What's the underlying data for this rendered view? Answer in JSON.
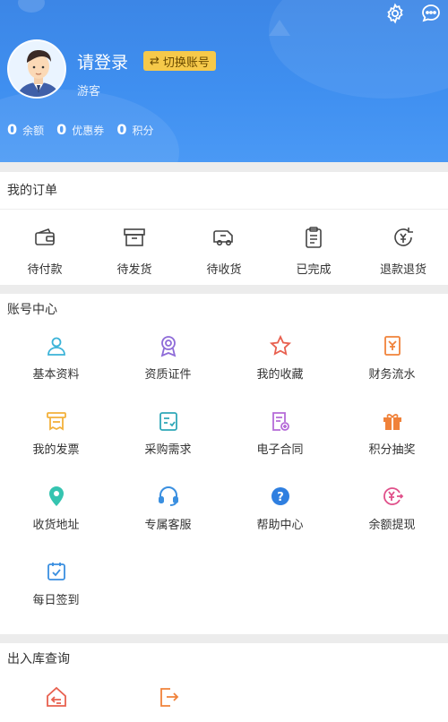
{
  "header": {
    "login_text": "请登录",
    "switch_label": "切换账号",
    "guest_label": "游客",
    "stats": [
      {
        "value": "0",
        "label": "余额"
      },
      {
        "value": "0",
        "label": "优惠券"
      },
      {
        "value": "0",
        "label": "积分"
      }
    ]
  },
  "orders": {
    "title": "我的订单",
    "items": [
      {
        "label": "待付款",
        "icon": "wallet-icon"
      },
      {
        "label": "待发货",
        "icon": "box-icon"
      },
      {
        "label": "待收货",
        "icon": "truck-icon"
      },
      {
        "label": "已完成",
        "icon": "clipboard-icon"
      },
      {
        "label": "退款退货",
        "icon": "refund-icon"
      }
    ]
  },
  "account": {
    "title": "账号中心",
    "items": [
      {
        "label": "基本资料",
        "icon": "user-icon",
        "color": "#3bb3d8"
      },
      {
        "label": "资质证件",
        "icon": "award-icon",
        "color": "#8e6bd8"
      },
      {
        "label": "我的收藏",
        "icon": "star-icon",
        "color": "#e8604f"
      },
      {
        "label": "财务流水",
        "icon": "finance-icon",
        "color": "#f0823a"
      },
      {
        "label": "我的发票",
        "icon": "invoice-icon",
        "color": "#f3b13b"
      },
      {
        "label": "采购需求",
        "icon": "purchase-icon",
        "color": "#2fa7b8"
      },
      {
        "label": "电子合同",
        "icon": "contract-icon",
        "color": "#b56bd8"
      },
      {
        "label": "积分抽奖",
        "icon": "gift-icon",
        "color": "#f0823a"
      },
      {
        "label": "收货地址",
        "icon": "location-icon",
        "color": "#35c4b0"
      },
      {
        "label": "专属客服",
        "icon": "headset-icon",
        "color": "#3a8fe0"
      },
      {
        "label": "帮助中心",
        "icon": "help-icon",
        "color": "#2f7fe0"
      },
      {
        "label": "余额提现",
        "icon": "withdraw-icon",
        "color": "#e0508a"
      },
      {
        "label": "每日签到",
        "icon": "calendar-check-icon",
        "color": "#3a8fe0"
      }
    ]
  },
  "stock": {
    "title": "出入库查询",
    "items": [
      {
        "icon": "inbound-icon",
        "color": "#e8604f"
      },
      {
        "icon": "outbound-icon",
        "color": "#f0823a"
      }
    ]
  }
}
